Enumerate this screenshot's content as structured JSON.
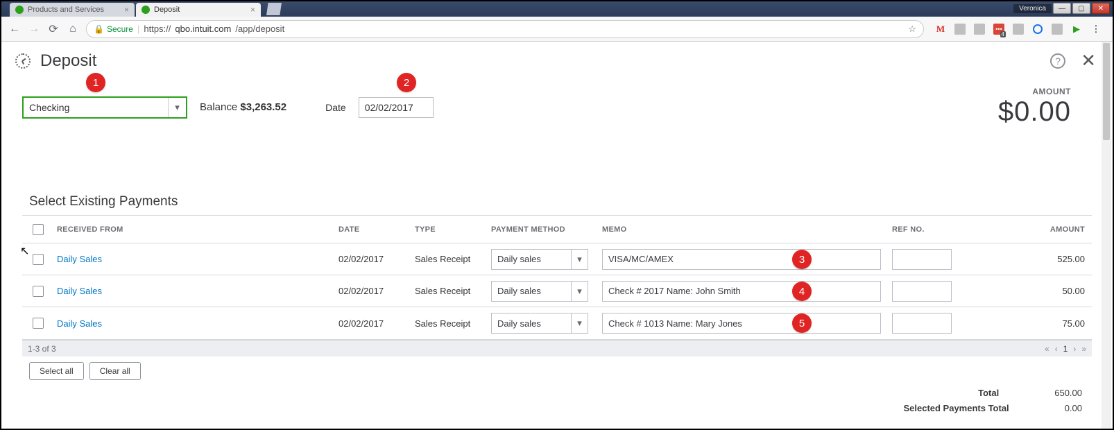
{
  "browser": {
    "user": "Veronica",
    "tabs": [
      {
        "title": "Products and Services"
      },
      {
        "title": "Deposit"
      }
    ],
    "secure_label": "Secure",
    "url_prefix": "https://",
    "url_host": "qbo.intuit.com",
    "url_path": "/app/deposit"
  },
  "header": {
    "title": "Deposit"
  },
  "form": {
    "account_value": "Checking",
    "balance_label": "Balance",
    "balance_value": "$3,263.52",
    "date_label": "Date",
    "date_value": "02/02/2017",
    "amount_label": "AMOUNT",
    "amount_value": "$0.00"
  },
  "section": {
    "title": "Select Existing Payments"
  },
  "columns": {
    "received_from": "RECEIVED FROM",
    "date": "DATE",
    "type": "TYPE",
    "payment_method": "PAYMENT METHOD",
    "memo": "MEMO",
    "ref_no": "REF NO.",
    "amount": "AMOUNT"
  },
  "rows": [
    {
      "from": "Daily Sales",
      "date": "02/02/2017",
      "type": "Sales Receipt",
      "pm": "Daily sales",
      "memo": "VISA/MC/AMEX",
      "ref": "",
      "amount": "525.00"
    },
    {
      "from": "Daily Sales",
      "date": "02/02/2017",
      "type": "Sales Receipt",
      "pm": "Daily sales",
      "memo": "Check # 2017 Name: John Smith",
      "ref": "",
      "amount": "50.00"
    },
    {
      "from": "Daily Sales",
      "date": "02/02/2017",
      "type": "Sales Receipt",
      "pm": "Daily sales",
      "memo": "Check # 1013 Name: Mary Jones",
      "ref": "",
      "amount": "75.00"
    }
  ],
  "pager": {
    "range": "1-3 of 3",
    "page": "1"
  },
  "actions": {
    "select_all": "Select all",
    "clear_all": "Clear all"
  },
  "totals": {
    "total_label": "Total",
    "total_value": "650.00",
    "selected_label": "Selected Payments Total",
    "selected_value": "0.00"
  },
  "badges": {
    "b1": "1",
    "b2": "2",
    "b3": "3",
    "b4": "4",
    "b5": "5"
  }
}
